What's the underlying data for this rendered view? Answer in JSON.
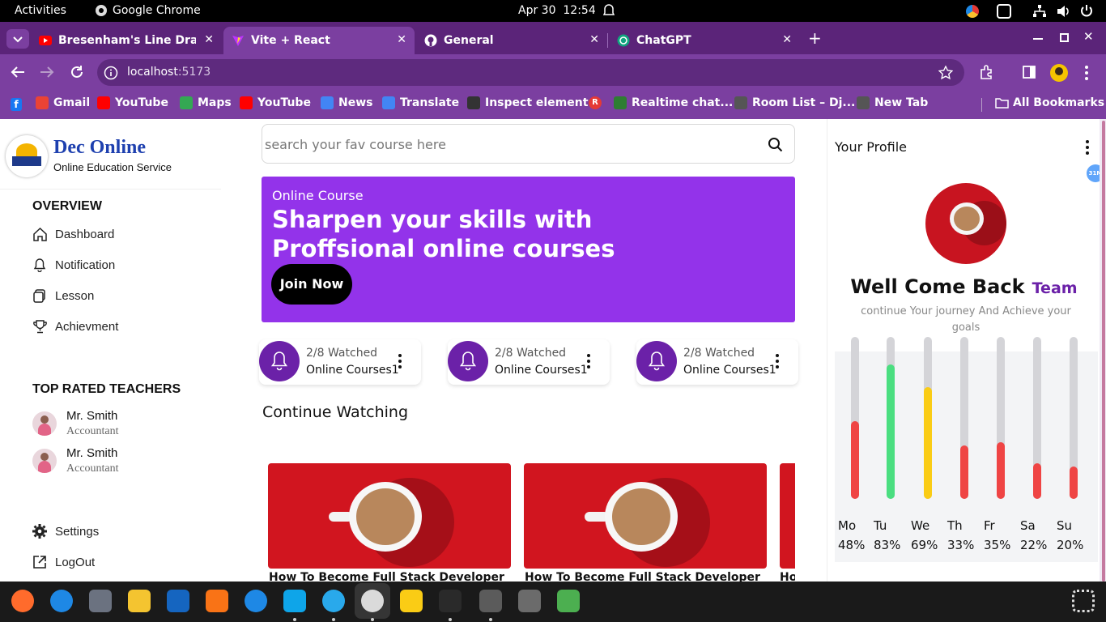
{
  "topbar": {
    "activities": "Activities",
    "app": "Google Chrome",
    "date": "Apr 30",
    "time": "12:54"
  },
  "tabs": [
    {
      "title": "Bresenham's Line Draw",
      "icon": "youtube-icon",
      "active": false
    },
    {
      "title": "Vite + React",
      "icon": "vite-icon",
      "active": true
    },
    {
      "title": "General",
      "icon": "github-icon",
      "active": false
    },
    {
      "title": "ChatGPT",
      "icon": "chatgpt-icon",
      "active": false
    }
  ],
  "address": {
    "host": "localhost",
    "port": ":5173"
  },
  "bookmarks": [
    {
      "label": "Gmail",
      "icon": "gmail-icon",
      "color": "#ea4335"
    },
    {
      "label": "YouTube",
      "icon": "youtube-icon",
      "color": "#ff0000"
    },
    {
      "label": "Maps",
      "icon": "maps-icon",
      "color": "#34a853"
    },
    {
      "label": "YouTube",
      "icon": "youtube-icon",
      "color": "#ff0000"
    },
    {
      "label": "News",
      "icon": "news-icon",
      "color": "#4285f4"
    },
    {
      "label": "Translate",
      "icon": "translate-icon",
      "color": "#4285f4"
    },
    {
      "label": "Inspect element",
      "icon": "inspect-icon",
      "color": "#333333"
    },
    {
      "label": "",
      "icon": "r-icon",
      "color": "#e53935"
    },
    {
      "label": "Realtime chat...",
      "icon": "chat-icon",
      "color": "#2e7d32"
    },
    {
      "label": "Room List – Dj...",
      "icon": "globe-icon",
      "color": "#555555"
    },
    {
      "label": "New Tab",
      "icon": "globe-icon",
      "color": "#555555"
    }
  ],
  "all_bookmarks": "All Bookmarks",
  "brand": {
    "name": "Dec Online",
    "tagline": "Online Education Service"
  },
  "sidebar": {
    "overview": "OVERVIEW",
    "items": [
      {
        "label": "Dashboard",
        "icon": "home-icon"
      },
      {
        "label": "Notification",
        "icon": "bell-icon"
      },
      {
        "label": "Lesson",
        "icon": "lesson-icon"
      },
      {
        "label": "Achievment",
        "icon": "trophy-icon"
      }
    ],
    "teachers_heading": "TOP RATED TEACHERS",
    "teachers": [
      {
        "name": "Mr. Smith",
        "role": "Accountant"
      },
      {
        "name": "Mr. Smith",
        "role": "Accountant"
      }
    ],
    "settings": "Settings",
    "logout": "LogOut"
  },
  "search": {
    "placeholder": "search your fav course here"
  },
  "banner": {
    "kicker": "Online Course",
    "headline_1": "Sharpen your skills with",
    "headline_2": "Proffsional online courses",
    "cta": "Join Now",
    "color": "#9333ea"
  },
  "stats": [
    {
      "watched": "2/8 Watched",
      "course": "Online Courses1"
    },
    {
      "watched": "2/8 Watched",
      "course": "Online Courses1"
    },
    {
      "watched": "2/8 Watched",
      "course": "Online Courses1"
    }
  ],
  "continue_heading": "Continue Watching",
  "cards": [
    {
      "title": "How To Become Full Stack Developer"
    },
    {
      "title": "How To Become Full Stack Developer"
    },
    {
      "title": "Ho"
    }
  ],
  "profile": {
    "heading": "Your Profile",
    "greeting": "Well Come Back",
    "name": "Team",
    "subtitle": "continue Your journey And Achieve your goals",
    "badge": "31M"
  },
  "activity": [
    {
      "day": "Mo",
      "pct": "48%",
      "value": 0.48,
      "color": "#ef4444"
    },
    {
      "day": "Tu",
      "pct": "83%",
      "value": 0.83,
      "color": "#4ade80"
    },
    {
      "day": "We",
      "pct": "69%",
      "value": 0.69,
      "color": "#facc15"
    },
    {
      "day": "Th",
      "pct": "33%",
      "value": 0.33,
      "color": "#ef4444"
    },
    {
      "day": "Fr",
      "pct": "35%",
      "value": 0.35,
      "color": "#ef4444"
    },
    {
      "day": "Sa",
      "pct": "22%",
      "value": 0.22,
      "color": "#ef4444"
    },
    {
      "day": "Su",
      "pct": "20%",
      "value": 0.2,
      "color": "#ef4444"
    }
  ],
  "dock": [
    "firefox-icon",
    "thunderbird-icon",
    "files-icon",
    "rhythmbox-icon",
    "writer-icon",
    "software-icon",
    "help-icon",
    "vscode-icon",
    "telegram-icon",
    "chrome-icon",
    "calculator-icon",
    "terminal-icon",
    "settings-icon",
    "text-editor-icon",
    "trash-icon",
    "app-grid-icon"
  ]
}
